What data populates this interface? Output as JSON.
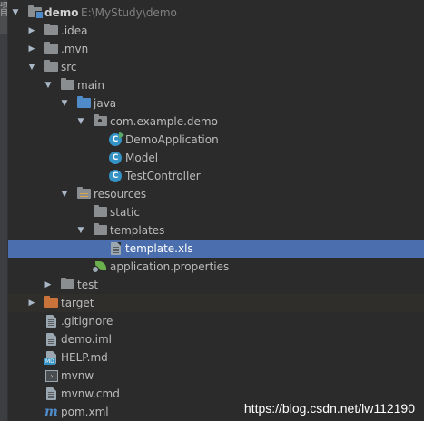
{
  "side_strip": {
    "label": "项目"
  },
  "project": {
    "name": "demo",
    "path": "E:\\MyStudy\\demo"
  },
  "tree": {
    "idea": ".idea",
    "mvn": ".mvn",
    "src": "src",
    "main": "main",
    "java": "java",
    "package": "com.example.demo",
    "demo_application": "DemoApplication",
    "model": "Model",
    "test_controller": "TestController",
    "resources": "resources",
    "static": "static",
    "templates": "templates",
    "template_xls": "template.xls",
    "application_properties": "application.properties",
    "test": "test",
    "target": "target",
    "gitignore": ".gitignore",
    "demo_iml": "demo.iml",
    "help_md": "HELP.md",
    "mvnw": "mvnw",
    "mvnw_cmd": "mvnw.cmd",
    "pom_xml": "pom.xml"
  },
  "class_icon_letter": "C",
  "md_badge": "MD",
  "maven_glyph": "m",
  "watermark": "https://blog.csdn.net/lw112190",
  "colors": {
    "background": "#2b2b2b",
    "selection": "#4b6eaf",
    "source_folder": "#4f8ac9",
    "excluded_folder": "#c9733a",
    "class_icon": "#3592c4"
  }
}
